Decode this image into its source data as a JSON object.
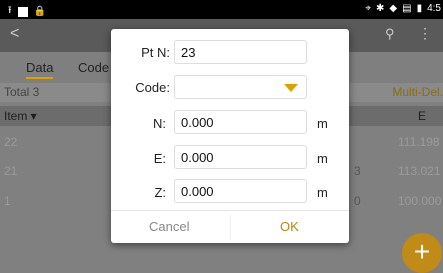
{
  "statusbar": {
    "time": "4:5",
    "left_icons": [
      "upload-icon",
      "square-icon",
      "lock-icon"
    ],
    "right_icons": [
      "location-icon",
      "bluetooth-icon",
      "wifi-icon",
      "signal-icon",
      "battery-icon"
    ]
  },
  "appbar": {
    "back": "<",
    "search": "⚲",
    "more": "⋮"
  },
  "tabs": [
    {
      "label": "Data"
    },
    {
      "label": "Code"
    }
  ],
  "summary": {
    "total": "Total 3",
    "multi_delete": "Multi-Del."
  },
  "table": {
    "headers": {
      "item": "Item ▾",
      "e": "E"
    },
    "rows": [
      {
        "id": "22",
        "mid": "",
        "e": "111.198"
      },
      {
        "id": "21",
        "mid": "3",
        "e": "113.021"
      },
      {
        "id": "1",
        "mid": "0",
        "e": "100.000"
      }
    ]
  },
  "dialog": {
    "ptn_label": "Pt N:",
    "ptn_value": "23",
    "code_label": "Code:",
    "code_value": "",
    "n_label": "N:",
    "n_value": "0.000",
    "e_label": "E:",
    "e_value": "0.000",
    "z_label": "Z:",
    "z_value": "0.000",
    "unit": "m",
    "cancel": "Cancel",
    "ok": "OK"
  },
  "colors": {
    "accent": "#e0a000",
    "ok_text": "#b8860b",
    "cancel_text": "#888888"
  },
  "fab_icon": "plus-icon"
}
